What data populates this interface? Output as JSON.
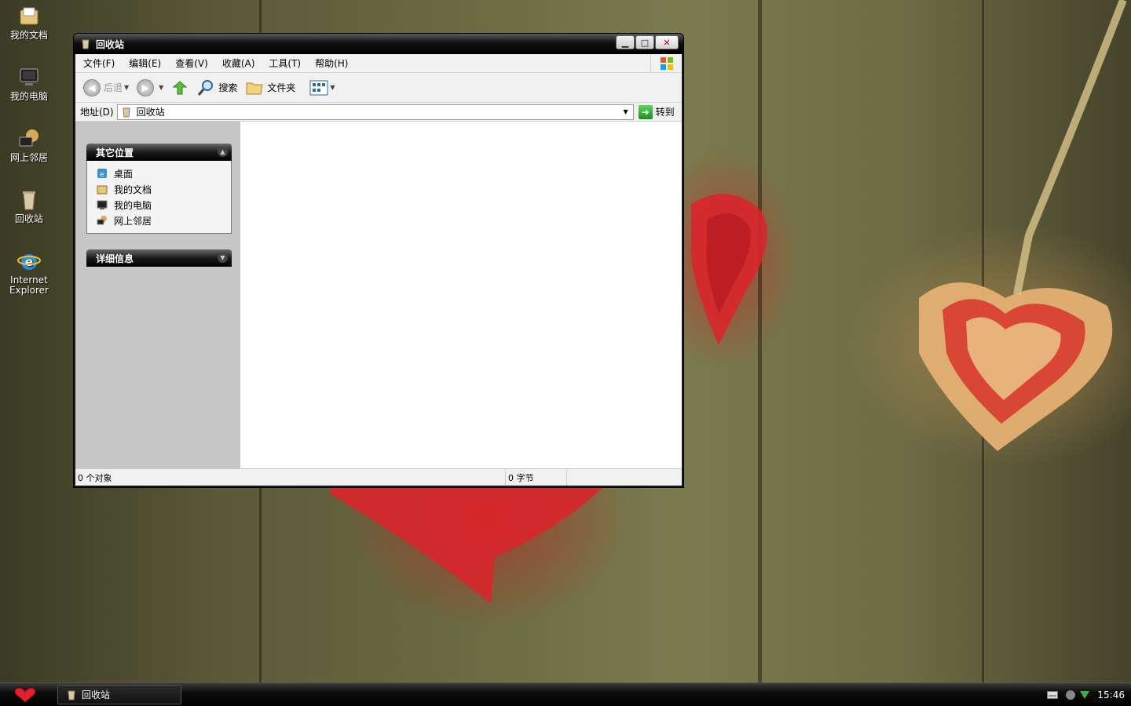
{
  "desktop": {
    "icons": [
      {
        "label": "我的文档"
      },
      {
        "label": "我的电脑"
      },
      {
        "label": "网上邻居"
      },
      {
        "label": "回收站"
      },
      {
        "label": "Internet Explorer"
      }
    ]
  },
  "window": {
    "title": "回收站",
    "menu": [
      "文件(F)",
      "编辑(E)",
      "查看(V)",
      "收藏(A)",
      "工具(T)",
      "帮助(H)"
    ],
    "toolbar": {
      "back_label": "后退",
      "search_label": "搜索",
      "folders_label": "文件夹"
    },
    "address": {
      "label": "地址(D)",
      "value": "回收站",
      "go_label": "转到"
    },
    "panels": {
      "other_places": {
        "title": "其它位置",
        "items": [
          "桌面",
          "我的文档",
          "我的电脑",
          "网上邻居"
        ]
      },
      "details": {
        "title": "详细信息"
      }
    },
    "status": {
      "objects": "0 个对象",
      "size": "0 字节"
    }
  },
  "taskbar": {
    "task_label": "回收站",
    "clock": "15:46"
  },
  "colors": {
    "titlebar": "#000000",
    "left_pane": "#c6c6c6",
    "chrome": "#f1f1f1",
    "accent_heart": "#d9262b"
  }
}
